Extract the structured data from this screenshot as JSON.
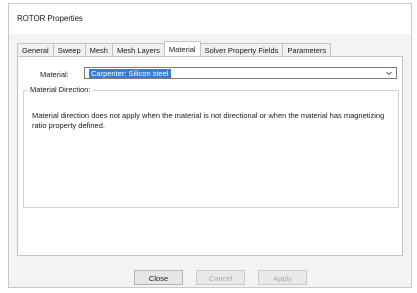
{
  "window": {
    "title": "ROTOR Properties"
  },
  "tabs": [
    {
      "label": "General",
      "active": false
    },
    {
      "label": "Sweep",
      "active": false
    },
    {
      "label": "Mesh",
      "active": false
    },
    {
      "label": "Mesh Layers",
      "active": false
    },
    {
      "label": "Material",
      "active": true
    },
    {
      "label": "Solver Property Fields",
      "active": false
    },
    {
      "label": "Parameters",
      "active": false
    }
  ],
  "material_tab": {
    "material_label": "Material:",
    "material_value": "Carpenter: Silicon steel",
    "dropdown_icon": "chevron-down-icon",
    "direction_group": {
      "title": "Material Direction:",
      "message": "Material direction does not apply when the material is not directional or when the material has magnetizing ratio property defined."
    }
  },
  "buttons": {
    "close": {
      "label": "Close",
      "enabled": true
    },
    "cancel": {
      "label": "Cancel",
      "enabled": false
    },
    "apply": {
      "label": "Apply",
      "enabled": false
    }
  },
  "colors": {
    "selection_highlight": "#3a7bd5",
    "dialog_background": "#f3f3f3",
    "disabled_text": "#a8a8a8"
  }
}
